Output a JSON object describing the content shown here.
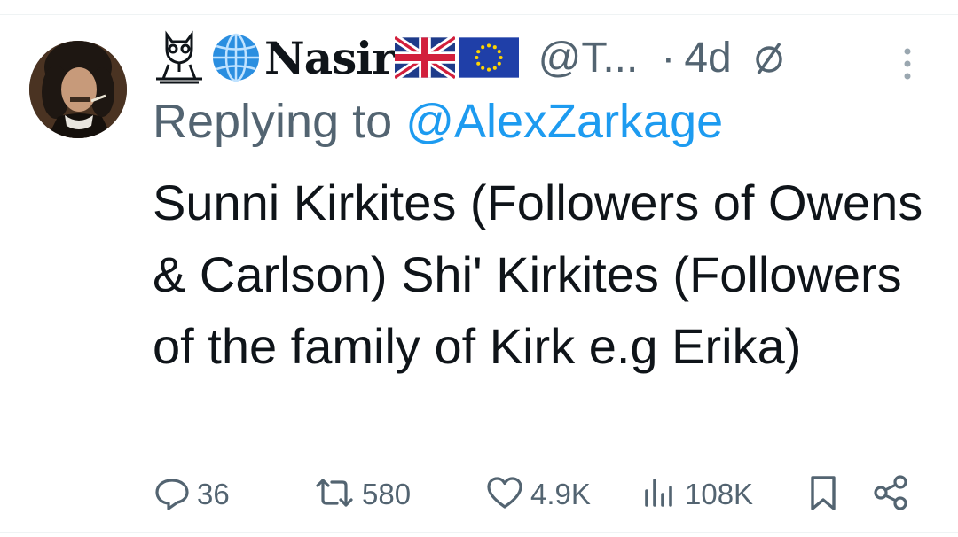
{
  "tweet": {
    "display_name": "Nasir",
    "handle": "@T...",
    "separator": "·",
    "time": "4d",
    "replying_prefix": "Replying to",
    "replying_to": "@AlexZarkage",
    "text": "Sunni Kirkites (Followers of Owens & Carlson) Shi' Kirkites (Followers of the family of Kirk e.g Erika)"
  },
  "header_icons": [
    "owl-icon",
    "globe-icon",
    "uk-flag-icon",
    "eu-flag-icon",
    "no-entry-icon",
    "more-icon"
  ],
  "actions": {
    "replies": "36",
    "reposts": "580",
    "likes": "4.9K",
    "views": "108K"
  },
  "colors": {
    "primary_text": "#0f1419",
    "secondary_text": "#536471",
    "link": "#1d9bf0",
    "divider": "#eff3f4"
  }
}
